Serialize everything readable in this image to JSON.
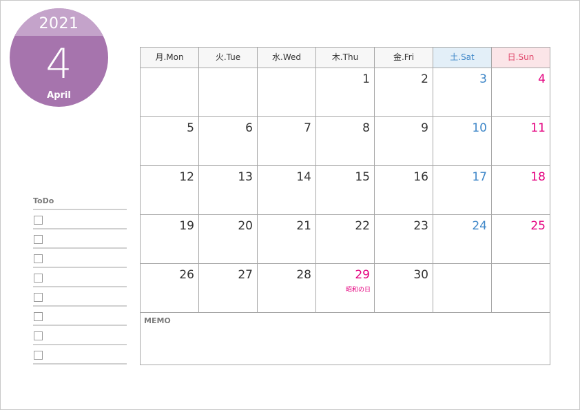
{
  "badge": {
    "year": "2021",
    "month_number": "4",
    "month_name": "April",
    "colors": {
      "top": "#c4a3ca",
      "main": "#a674ad"
    }
  },
  "todo": {
    "title": "ToDo",
    "items": [
      "",
      "",
      "",
      "",
      "",
      "",
      "",
      ""
    ]
  },
  "calendar": {
    "weekdays": [
      {
        "label": "月.Mon",
        "type": "weekday"
      },
      {
        "label": "火.Tue",
        "type": "weekday"
      },
      {
        "label": "水.Wed",
        "type": "weekday"
      },
      {
        "label": "木.Thu",
        "type": "weekday"
      },
      {
        "label": "金.Fri",
        "type": "weekday"
      },
      {
        "label": "土.Sat",
        "type": "sat"
      },
      {
        "label": "日.Sun",
        "type": "sun"
      }
    ],
    "weeks": [
      [
        "",
        "",
        "",
        "1",
        "2",
        "3",
        "4"
      ],
      [
        "5",
        "6",
        "7",
        "8",
        "9",
        "10",
        "11"
      ],
      [
        "12",
        "13",
        "14",
        "15",
        "16",
        "17",
        "18"
      ],
      [
        "19",
        "20",
        "21",
        "22",
        "23",
        "24",
        "25"
      ],
      [
        "26",
        "27",
        "28",
        "29",
        "30",
        "",
        ""
      ]
    ],
    "holidays": [
      {
        "day": "29",
        "name": "昭和の日"
      }
    ],
    "memo_label": "MEMO",
    "colors": {
      "saturday": "#3f87c8",
      "sunday": "#e4007f",
      "holiday": "#e4007f"
    }
  }
}
